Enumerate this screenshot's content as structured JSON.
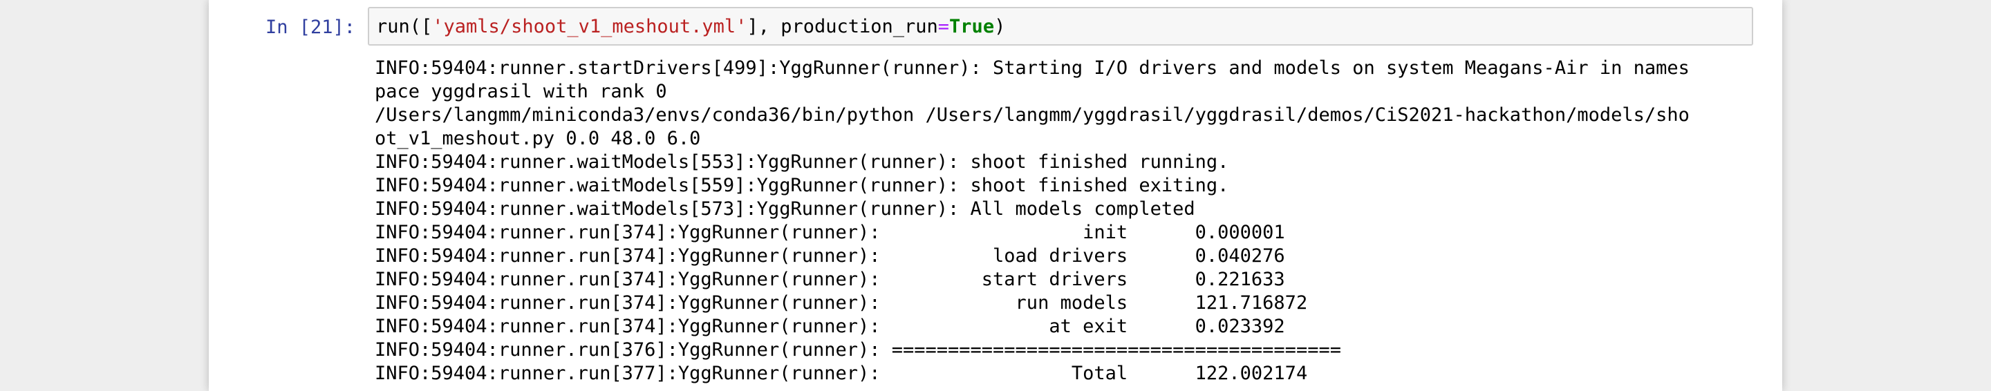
{
  "cell": {
    "prompt": "In [21]:",
    "code": {
      "fn_open": "run([",
      "string": "'yamls/shoot_v1_meshout.yml'",
      "arg_sep": "], production_run",
      "op": "=",
      "kw": "True",
      "close": ")"
    },
    "output_lines": [
      "INFO:59404:runner.startDrivers[499]:YggRunner(runner): Starting I/O drivers and models on system Meagans-Air in names",
      "pace yggdrasil with rank 0",
      "/Users/langmm/miniconda3/envs/conda36/bin/python /Users/langmm/yggdrasil/yggdrasil/demos/CiS2021-hackathon/models/sho",
      "ot_v1_meshout.py 0.0 48.0 6.0",
      "INFO:59404:runner.waitModels[553]:YggRunner(runner): shoot finished running.",
      "INFO:59404:runner.waitModels[559]:YggRunner(runner): shoot finished exiting.",
      "INFO:59404:runner.waitModels[573]:YggRunner(runner): All models completed",
      "INFO:59404:runner.run[374]:YggRunner(runner):                  init      0.000001",
      "INFO:59404:runner.run[374]:YggRunner(runner):          load drivers      0.040276",
      "INFO:59404:runner.run[374]:YggRunner(runner):         start drivers      0.221633",
      "INFO:59404:runner.run[374]:YggRunner(runner):            run models      121.716872",
      "INFO:59404:runner.run[374]:YggRunner(runner):               at exit      0.023392",
      "INFO:59404:runner.run[376]:YggRunner(runner): ========================================",
      "INFO:59404:runner.run[377]:YggRunner(runner):                 Total      122.002174"
    ]
  }
}
